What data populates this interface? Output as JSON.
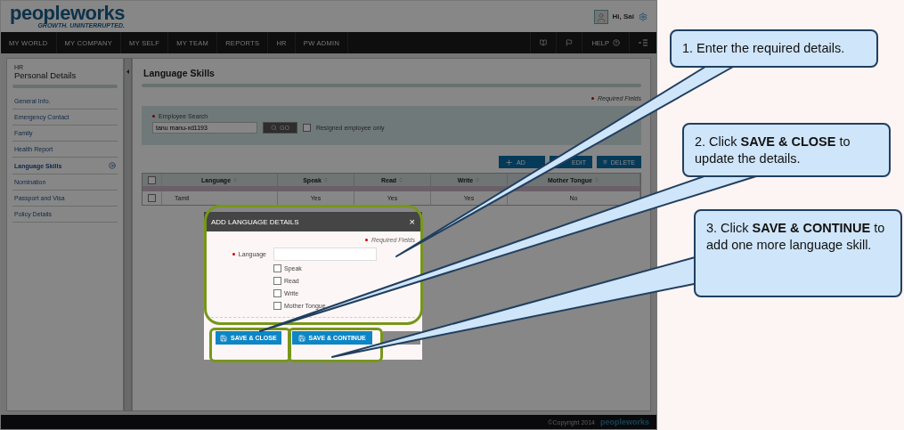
{
  "header": {
    "logo": "peopleworks",
    "tagline": "GROWTH. UNINTERRUPTED.",
    "greeting": "Hi, Sai"
  },
  "nav": {
    "items": [
      {
        "label": "MY WORLD"
      },
      {
        "label": "MY COMPANY"
      },
      {
        "label": "MY SELF"
      },
      {
        "label": "MY TEAM"
      },
      {
        "label": "REPORTS"
      },
      {
        "label": "HR"
      },
      {
        "label": "PW ADMIN"
      }
    ],
    "help": "HELP"
  },
  "sidebar": {
    "section": "HR",
    "title": "Personal Details",
    "items": [
      {
        "label": "General Info.",
        "selected": false
      },
      {
        "label": "Emergency Contact",
        "selected": false
      },
      {
        "label": "Family",
        "selected": false
      },
      {
        "label": "Health Report",
        "selected": false
      },
      {
        "label": "Language Skills",
        "selected": true
      },
      {
        "label": "Nomination",
        "selected": false
      },
      {
        "label": "Passport and Visa",
        "selected": false
      },
      {
        "label": "Policy Details",
        "selected": false
      }
    ]
  },
  "page": {
    "title": "Language Skills",
    "required_note": "Required Fields",
    "search": {
      "label": "Employee Search",
      "value": "tanu manu-xd1193",
      "button": "GO",
      "resigned": {
        "label": "Resigned employee only",
        "checked": false
      }
    },
    "actions": [
      {
        "kind": "add",
        "label": "AD"
      },
      {
        "kind": "edit",
        "label": "EDIT"
      },
      {
        "kind": "delete",
        "label": "DELETE"
      }
    ],
    "table": {
      "select_all": {
        "checked": false
      },
      "columns": [
        "Language",
        "Speak",
        "Read",
        "Write",
        "Mother Tongue"
      ],
      "rows": [
        {
          "selected": false,
          "cells": [
            "Tamil",
            "Yes",
            "Yes",
            "Yes",
            "No"
          ]
        }
      ]
    }
  },
  "dialog": {
    "title": "ADD LANGUAGE DETAILS",
    "close": "×",
    "required_note": "Required Fields",
    "language_label": "Language",
    "options": [
      {
        "label": "Speak",
        "checked": false
      },
      {
        "label": "Read",
        "checked": false
      },
      {
        "label": "Write",
        "checked": false
      },
      {
        "label": "Mother Tongue",
        "checked": false
      }
    ],
    "buttons": [
      {
        "kind": "primary",
        "label": "SAVE & CLOSE"
      },
      {
        "kind": "primary",
        "label": "SAVE & CONTINUE"
      },
      {
        "kind": "secondary"
      }
    ]
  },
  "footer": {
    "copyright": "©Copyright 2014",
    "logo": "peopleworks"
  },
  "callouts": [
    {
      "text": "1. Enter the required details."
    },
    {
      "text": "2. Click **SAVE & CLOSE** to update the details."
    },
    {
      "text": "3. Click **SAVE & CONTINUE** to add one more language skill."
    }
  ]
}
